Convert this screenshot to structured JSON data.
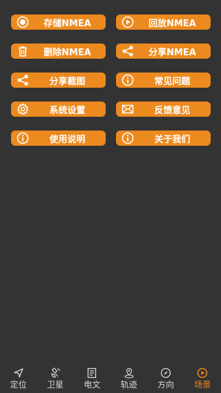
{
  "buttons": [
    {
      "label": "存储NMEA",
      "icon": "record-icon"
    },
    {
      "label": "回放NMEA",
      "icon": "play-icon"
    },
    {
      "label": "删除NMEA",
      "icon": "trash-icon"
    },
    {
      "label": "分享NMEA",
      "icon": "share-icon"
    },
    {
      "label": "分享截图",
      "icon": "share-icon"
    },
    {
      "label": "常见问题",
      "icon": "info-icon"
    },
    {
      "label": "系统设置",
      "icon": "gear-icon"
    },
    {
      "label": "反馈意见",
      "icon": "mail-icon"
    },
    {
      "label": "使用说明",
      "icon": "info-icon"
    },
    {
      "label": "关于我们",
      "icon": "info-icon"
    }
  ],
  "tabs": [
    {
      "label": "定位",
      "icon": "navigation-arrow-icon"
    },
    {
      "label": "卫星",
      "icon": "satellite-icon"
    },
    {
      "label": "电文",
      "icon": "document-icon"
    },
    {
      "label": "轨迹",
      "icon": "location-pin-icon"
    },
    {
      "label": "方向",
      "icon": "compass-icon"
    },
    {
      "label": "场景",
      "icon": "play-circle-icon"
    }
  ],
  "active_tab": "场景",
  "colors": {
    "accent": "#EC8A1F",
    "background": "#333333",
    "tab_text": "#d8d8d8"
  }
}
